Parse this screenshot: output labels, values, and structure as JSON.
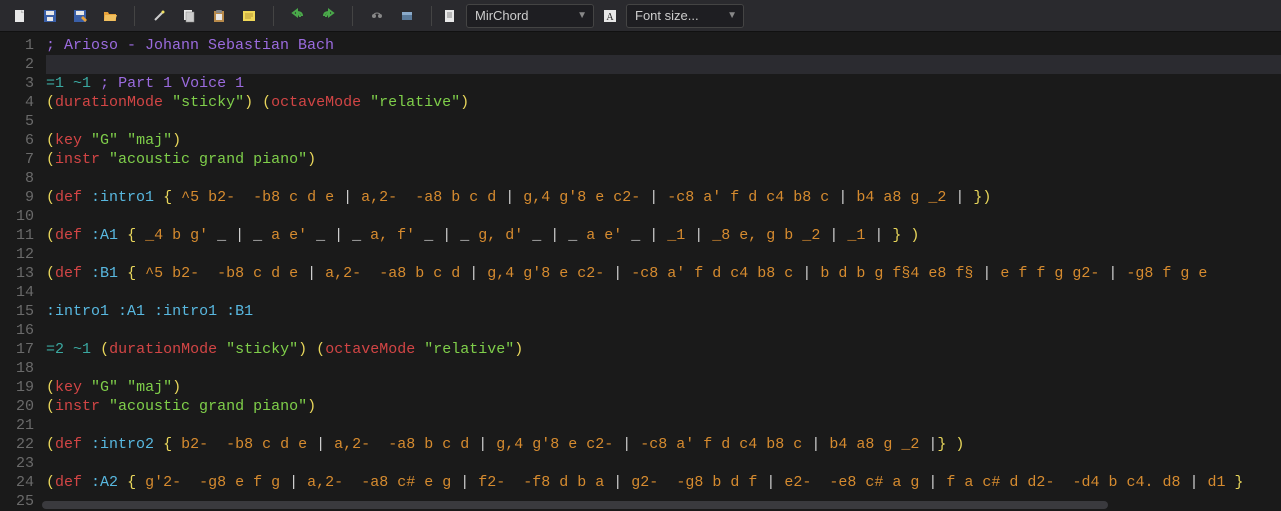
{
  "toolbar": {
    "dropdown1": {
      "label": "MirChord"
    },
    "dropdown2": {
      "label": "Font size..."
    }
  },
  "icons": {
    "new": "new-file-icon",
    "save": "save-icon",
    "saveas": "saveas-icon",
    "open": "open-folder-icon",
    "wand": "wand-icon",
    "copy": "copy-icon",
    "paste": "paste-icon",
    "note": "sticky-note-icon",
    "undo": "undo-icon",
    "redo": "redo-icon",
    "play": "play-icon",
    "stop": "stop-icon"
  },
  "code": {
    "lines": [
      {
        "n": 1,
        "seg": [
          {
            "c": "c-comment",
            "t": "; Arioso - Johann Sebastian Bach"
          }
        ]
      },
      {
        "n": 2,
        "current": true,
        "seg": []
      },
      {
        "n": 3,
        "seg": [
          {
            "c": "c-teal",
            "t": "=1"
          },
          {
            "c": "c-plain",
            "t": " "
          },
          {
            "c": "c-teal",
            "t": "~1"
          },
          {
            "c": "c-plain",
            "t": " "
          },
          {
            "c": "c-comment",
            "t": "; Part 1 Voice 1"
          }
        ]
      },
      {
        "n": 4,
        "seg": [
          {
            "c": "c-paren",
            "t": "("
          },
          {
            "c": "c-kw",
            "t": "durationMode"
          },
          {
            "c": "c-plain",
            "t": " "
          },
          {
            "c": "c-str",
            "t": "\"sticky\""
          },
          {
            "c": "c-paren",
            "t": ")"
          },
          {
            "c": "c-plain",
            "t": " "
          },
          {
            "c": "c-paren",
            "t": "("
          },
          {
            "c": "c-kw",
            "t": "octaveMode"
          },
          {
            "c": "c-plain",
            "t": " "
          },
          {
            "c": "c-str",
            "t": "\"relative\""
          },
          {
            "c": "c-paren",
            "t": ")"
          }
        ]
      },
      {
        "n": 5,
        "seg": []
      },
      {
        "n": 6,
        "seg": [
          {
            "c": "c-paren",
            "t": "("
          },
          {
            "c": "c-kw",
            "t": "key"
          },
          {
            "c": "c-plain",
            "t": " "
          },
          {
            "c": "c-str",
            "t": "\"G\""
          },
          {
            "c": "c-plain",
            "t": " "
          },
          {
            "c": "c-str",
            "t": "\"maj\""
          },
          {
            "c": "c-paren",
            "t": ")"
          }
        ]
      },
      {
        "n": 7,
        "seg": [
          {
            "c": "c-paren",
            "t": "("
          },
          {
            "c": "c-kw",
            "t": "instr"
          },
          {
            "c": "c-plain",
            "t": " "
          },
          {
            "c": "c-str",
            "t": "\"acoustic grand piano\""
          },
          {
            "c": "c-paren",
            "t": ")"
          }
        ]
      },
      {
        "n": 8,
        "seg": []
      },
      {
        "n": 9,
        "seg": [
          {
            "c": "c-paren",
            "t": "("
          },
          {
            "c": "c-kw",
            "t": "def"
          },
          {
            "c": "c-plain",
            "t": " "
          },
          {
            "c": "c-sym",
            "t": ":intro1"
          },
          {
            "c": "c-plain",
            "t": " "
          },
          {
            "c": "c-brace",
            "t": "{"
          },
          {
            "c": "c-plain",
            "t": " "
          },
          {
            "c": "c-note",
            "t": "^5 b2-"
          },
          {
            "c": "c-plain",
            "t": "  "
          },
          {
            "c": "c-note",
            "t": "-b8 c d e"
          },
          {
            "c": "c-plain",
            "t": " | "
          },
          {
            "c": "c-note",
            "t": "a,2-"
          },
          {
            "c": "c-plain",
            "t": "  "
          },
          {
            "c": "c-note",
            "t": "-a8 b c d"
          },
          {
            "c": "c-plain",
            "t": " | "
          },
          {
            "c": "c-note",
            "t": "g,4 g'8 e c2-"
          },
          {
            "c": "c-plain",
            "t": " | "
          },
          {
            "c": "c-note",
            "t": "-c8 a' f d c4 b8 c"
          },
          {
            "c": "c-plain",
            "t": " | "
          },
          {
            "c": "c-note",
            "t": "b4 a8 g _2"
          },
          {
            "c": "c-plain",
            "t": " | "
          },
          {
            "c": "c-brace",
            "t": "}"
          },
          {
            "c": "c-paren",
            "t": ")"
          }
        ]
      },
      {
        "n": 10,
        "seg": []
      },
      {
        "n": 11,
        "seg": [
          {
            "c": "c-paren",
            "t": "("
          },
          {
            "c": "c-kw",
            "t": "def"
          },
          {
            "c": "c-plain",
            "t": " "
          },
          {
            "c": "c-sym",
            "t": ":A1"
          },
          {
            "c": "c-plain",
            "t": " "
          },
          {
            "c": "c-brace",
            "t": "{"
          },
          {
            "c": "c-plain",
            "t": " "
          },
          {
            "c": "c-note",
            "t": "_4 b g'"
          },
          {
            "c": "c-plain",
            "t": " _ | _ "
          },
          {
            "c": "c-note",
            "t": "a e'"
          },
          {
            "c": "c-plain",
            "t": " _ | _ "
          },
          {
            "c": "c-note",
            "t": "a, f'"
          },
          {
            "c": "c-plain",
            "t": " _ | _ "
          },
          {
            "c": "c-note",
            "t": "g, d'"
          },
          {
            "c": "c-plain",
            "t": " _ | _ "
          },
          {
            "c": "c-note",
            "t": "a e'"
          },
          {
            "c": "c-plain",
            "t": " _ | "
          },
          {
            "c": "c-note",
            "t": "_1"
          },
          {
            "c": "c-plain",
            "t": " | "
          },
          {
            "c": "c-note",
            "t": "_8 e, g b _2"
          },
          {
            "c": "c-plain",
            "t": " | "
          },
          {
            "c": "c-note",
            "t": "_1"
          },
          {
            "c": "c-plain",
            "t": " | "
          },
          {
            "c": "c-brace",
            "t": "}"
          },
          {
            "c": "c-plain",
            "t": " "
          },
          {
            "c": "c-paren",
            "t": ")"
          }
        ]
      },
      {
        "n": 12,
        "seg": []
      },
      {
        "n": 13,
        "seg": [
          {
            "c": "c-paren",
            "t": "("
          },
          {
            "c": "c-kw",
            "t": "def"
          },
          {
            "c": "c-plain",
            "t": " "
          },
          {
            "c": "c-sym",
            "t": ":B1"
          },
          {
            "c": "c-plain",
            "t": " "
          },
          {
            "c": "c-brace",
            "t": "{"
          },
          {
            "c": "c-plain",
            "t": " "
          },
          {
            "c": "c-note",
            "t": "^5 b2-"
          },
          {
            "c": "c-plain",
            "t": "  "
          },
          {
            "c": "c-note",
            "t": "-b8 c d e"
          },
          {
            "c": "c-plain",
            "t": " | "
          },
          {
            "c": "c-note",
            "t": "a,2-"
          },
          {
            "c": "c-plain",
            "t": "  "
          },
          {
            "c": "c-note",
            "t": "-a8 b c d"
          },
          {
            "c": "c-plain",
            "t": " | "
          },
          {
            "c": "c-note",
            "t": "g,4 g'8 e c2-"
          },
          {
            "c": "c-plain",
            "t": " | "
          },
          {
            "c": "c-note",
            "t": "-c8 a' f d c4 b8 c"
          },
          {
            "c": "c-plain",
            "t": " | "
          },
          {
            "c": "c-note",
            "t": "b d b g f§4 e8 f§"
          },
          {
            "c": "c-plain",
            "t": " | "
          },
          {
            "c": "c-note",
            "t": "e f f g g2-"
          },
          {
            "c": "c-plain",
            "t": " | "
          },
          {
            "c": "c-note",
            "t": "-g8 f g e"
          }
        ]
      },
      {
        "n": 14,
        "seg": []
      },
      {
        "n": 15,
        "seg": [
          {
            "c": "c-sym",
            "t": ":intro1"
          },
          {
            "c": "c-plain",
            "t": " "
          },
          {
            "c": "c-sym",
            "t": ":A1"
          },
          {
            "c": "c-plain",
            "t": " "
          },
          {
            "c": "c-sym",
            "t": ":intro1"
          },
          {
            "c": "c-plain",
            "t": " "
          },
          {
            "c": "c-sym",
            "t": ":B1"
          }
        ]
      },
      {
        "n": 16,
        "seg": []
      },
      {
        "n": 17,
        "seg": [
          {
            "c": "c-teal",
            "t": "=2"
          },
          {
            "c": "c-plain",
            "t": " "
          },
          {
            "c": "c-teal",
            "t": "~1"
          },
          {
            "c": "c-plain",
            "t": " "
          },
          {
            "c": "c-paren",
            "t": "("
          },
          {
            "c": "c-kw",
            "t": "durationMode"
          },
          {
            "c": "c-plain",
            "t": " "
          },
          {
            "c": "c-str",
            "t": "\"sticky\""
          },
          {
            "c": "c-paren",
            "t": ")"
          },
          {
            "c": "c-plain",
            "t": " "
          },
          {
            "c": "c-paren",
            "t": "("
          },
          {
            "c": "c-kw",
            "t": "octaveMode"
          },
          {
            "c": "c-plain",
            "t": " "
          },
          {
            "c": "c-str",
            "t": "\"relative\""
          },
          {
            "c": "c-paren",
            "t": ")"
          }
        ]
      },
      {
        "n": 18,
        "seg": []
      },
      {
        "n": 19,
        "seg": [
          {
            "c": "c-paren",
            "t": "("
          },
          {
            "c": "c-kw",
            "t": "key"
          },
          {
            "c": "c-plain",
            "t": " "
          },
          {
            "c": "c-str",
            "t": "\"G\""
          },
          {
            "c": "c-plain",
            "t": " "
          },
          {
            "c": "c-str",
            "t": "\"maj\""
          },
          {
            "c": "c-paren",
            "t": ")"
          }
        ]
      },
      {
        "n": 20,
        "seg": [
          {
            "c": "c-paren",
            "t": "("
          },
          {
            "c": "c-kw",
            "t": "instr"
          },
          {
            "c": "c-plain",
            "t": " "
          },
          {
            "c": "c-str",
            "t": "\"acoustic grand piano\""
          },
          {
            "c": "c-paren",
            "t": ")"
          }
        ]
      },
      {
        "n": 21,
        "seg": []
      },
      {
        "n": 22,
        "seg": [
          {
            "c": "c-paren",
            "t": "("
          },
          {
            "c": "c-kw",
            "t": "def"
          },
          {
            "c": "c-plain",
            "t": " "
          },
          {
            "c": "c-sym",
            "t": ":intro2"
          },
          {
            "c": "c-plain",
            "t": " "
          },
          {
            "c": "c-brace",
            "t": "{"
          },
          {
            "c": "c-plain",
            "t": " "
          },
          {
            "c": "c-note",
            "t": "b2-"
          },
          {
            "c": "c-plain",
            "t": "  "
          },
          {
            "c": "c-note",
            "t": "-b8 c d e"
          },
          {
            "c": "c-plain",
            "t": " | "
          },
          {
            "c": "c-note",
            "t": "a,2-"
          },
          {
            "c": "c-plain",
            "t": "  "
          },
          {
            "c": "c-note",
            "t": "-a8 b c d"
          },
          {
            "c": "c-plain",
            "t": " | "
          },
          {
            "c": "c-note",
            "t": "g,4 g'8 e c2-"
          },
          {
            "c": "c-plain",
            "t": " | "
          },
          {
            "c": "c-note",
            "t": "-c8 a' f d c4 b8 c"
          },
          {
            "c": "c-plain",
            "t": " | "
          },
          {
            "c": "c-note",
            "t": "b4 a8 g _2"
          },
          {
            "c": "c-plain",
            "t": " |"
          },
          {
            "c": "c-brace",
            "t": "}"
          },
          {
            "c": "c-plain",
            "t": " "
          },
          {
            "c": "c-paren",
            "t": ")"
          }
        ]
      },
      {
        "n": 23,
        "seg": []
      },
      {
        "n": 24,
        "seg": [
          {
            "c": "c-paren",
            "t": "("
          },
          {
            "c": "c-kw",
            "t": "def"
          },
          {
            "c": "c-plain",
            "t": " "
          },
          {
            "c": "c-sym",
            "t": ":A2"
          },
          {
            "c": "c-plain",
            "t": " "
          },
          {
            "c": "c-brace",
            "t": "{"
          },
          {
            "c": "c-plain",
            "t": " "
          },
          {
            "c": "c-note",
            "t": "g'2-"
          },
          {
            "c": "c-plain",
            "t": "  "
          },
          {
            "c": "c-note",
            "t": "-g8 e f g"
          },
          {
            "c": "c-plain",
            "t": " | "
          },
          {
            "c": "c-note",
            "t": "a,2-"
          },
          {
            "c": "c-plain",
            "t": "  "
          },
          {
            "c": "c-note",
            "t": "-a8 c# e g"
          },
          {
            "c": "c-plain",
            "t": " | "
          },
          {
            "c": "c-note",
            "t": "f2-"
          },
          {
            "c": "c-plain",
            "t": "  "
          },
          {
            "c": "c-note",
            "t": "-f8 d b a"
          },
          {
            "c": "c-plain",
            "t": " | "
          },
          {
            "c": "c-note",
            "t": "g2-"
          },
          {
            "c": "c-plain",
            "t": "  "
          },
          {
            "c": "c-note",
            "t": "-g8 b d f"
          },
          {
            "c": "c-plain",
            "t": " | "
          },
          {
            "c": "c-note",
            "t": "e2-"
          },
          {
            "c": "c-plain",
            "t": "  "
          },
          {
            "c": "c-note",
            "t": "-e8 c# a g"
          },
          {
            "c": "c-plain",
            "t": " | "
          },
          {
            "c": "c-note",
            "t": "f a c# d d2-"
          },
          {
            "c": "c-plain",
            "t": "  "
          },
          {
            "c": "c-note",
            "t": "-d4 b c4. d8"
          },
          {
            "c": "c-plain",
            "t": " | "
          },
          {
            "c": "c-note",
            "t": "d1"
          },
          {
            "c": "c-plain",
            "t": " "
          },
          {
            "c": "c-brace",
            "t": "}"
          }
        ]
      },
      {
        "n": 25,
        "seg": []
      }
    ]
  }
}
